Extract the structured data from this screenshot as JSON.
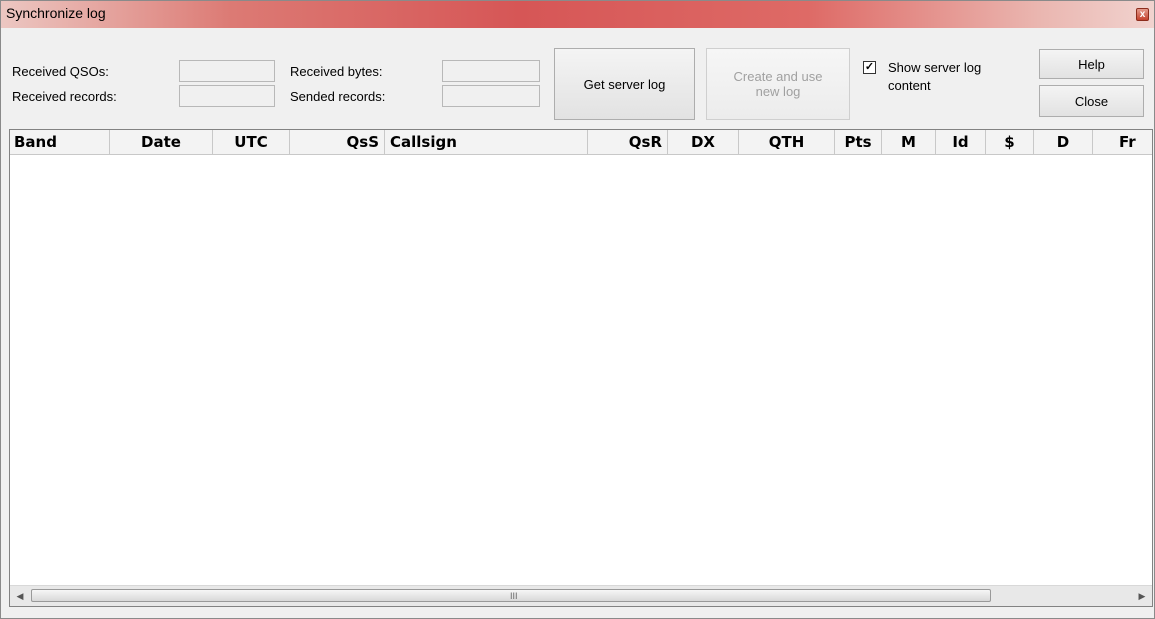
{
  "window": {
    "title": "Synchronize log",
    "close_glyph": "x"
  },
  "stats": {
    "received_qsos_label": "Received QSOs:",
    "received_qsos_value": "",
    "received_records_label": "Received records:",
    "received_records_value": "",
    "received_bytes_label": "Received bytes:",
    "received_bytes_value": "",
    "sended_records_label": "Sended records:",
    "sended_records_value": ""
  },
  "buttons": {
    "get_server_log": "Get server log",
    "create_new_log_line1": "Create and use",
    "create_new_log_line2": "new log",
    "help": "Help",
    "close": "Close"
  },
  "checkbox": {
    "label_line1": "Show server log",
    "label_line2": "content",
    "checked": true,
    "check_glyph": "✓"
  },
  "columns": [
    "Band",
    "Date",
    "UTC",
    "QsS",
    "Callsign",
    "QsR",
    "DX",
    "QTH",
    "Pts",
    "M",
    "Id",
    "$",
    "D",
    "Fr"
  ],
  "scrollbar": {
    "left_arrow": "◀",
    "right_arrow": "▶",
    "grip": "III"
  },
  "colors": {
    "titlebar_accent": "#d65656",
    "window_bg": "#f0f0f0",
    "grid_bg": "#ffffff"
  }
}
